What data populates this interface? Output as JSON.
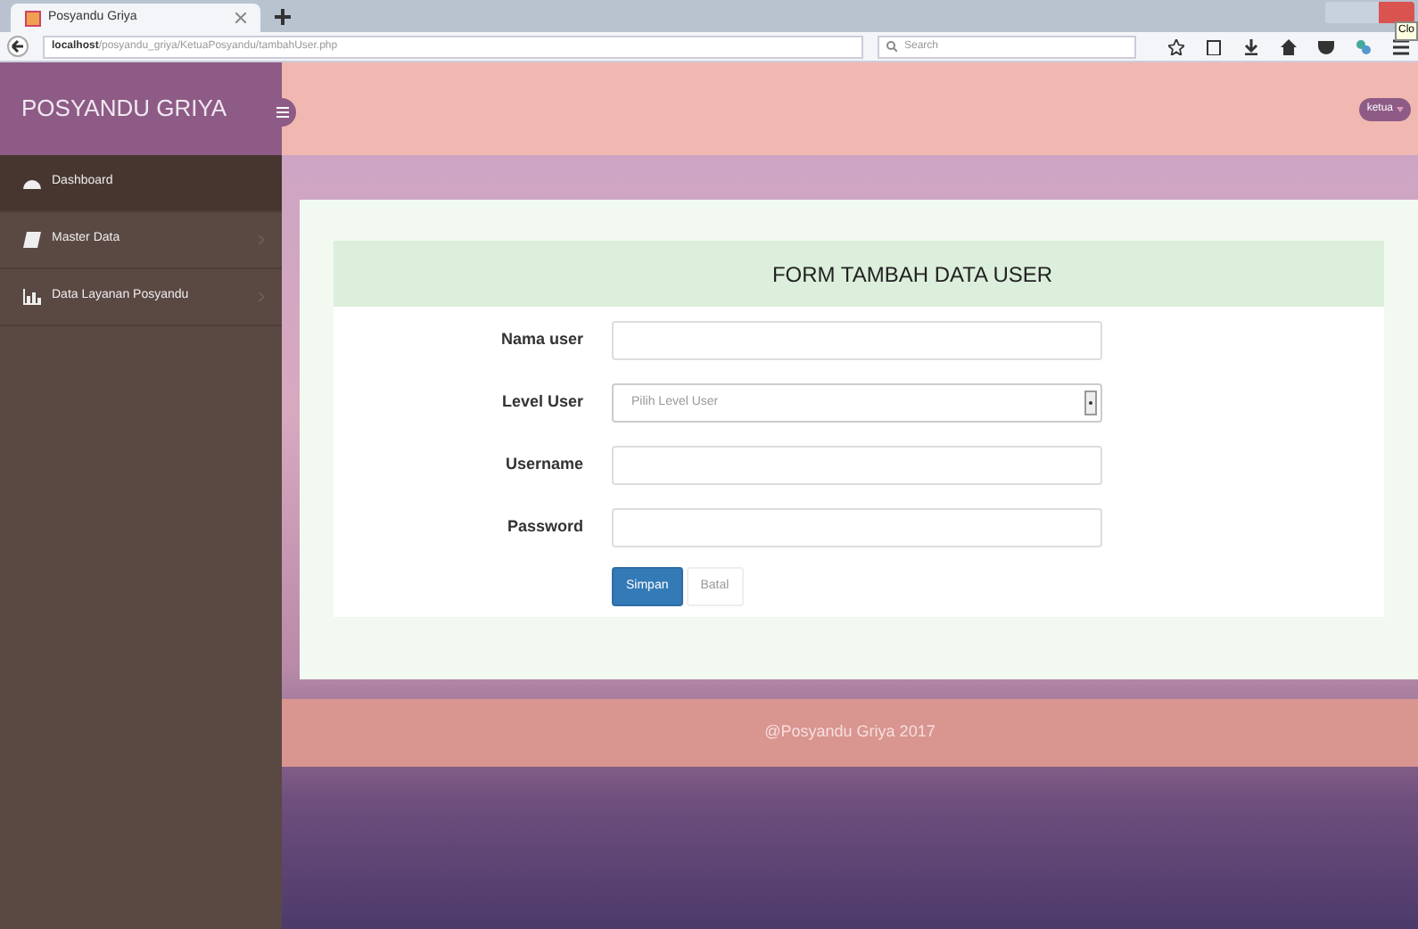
{
  "browser": {
    "tab_title": "Posyandu Griya",
    "url_host": "localhost",
    "url_path": "/posyandu_griya/KetuaPosyandu/tambahUser.php",
    "search_placeholder": "Search",
    "tooltip": "Clo"
  },
  "sidebar": {
    "brand": "POSYANDU GRIYA",
    "items": [
      {
        "label": "Dashboard",
        "selected": true,
        "kind": "dashboard",
        "has_submenu": false
      },
      {
        "label": "Master Data",
        "selected": false,
        "kind": "book",
        "has_submenu": true
      },
      {
        "label": "Data Layanan Posyandu",
        "selected": false,
        "kind": "chart",
        "has_submenu": true
      }
    ]
  },
  "header": {
    "user": "ketua"
  },
  "form": {
    "title": "FORM TAMBAH DATA USER",
    "fields": [
      {
        "label": "Nama user",
        "kind": "text"
      },
      {
        "label": "Level User",
        "kind": "select",
        "value": "Pilih Level User"
      },
      {
        "label": "Username",
        "kind": "text"
      },
      {
        "label": "Password",
        "kind": "password"
      }
    ],
    "buttons": [
      {
        "label": "Simpan",
        "primary": true
      },
      {
        "label": "Batal",
        "primary": false
      }
    ]
  },
  "footer": "@Posyandu Griya 2017"
}
